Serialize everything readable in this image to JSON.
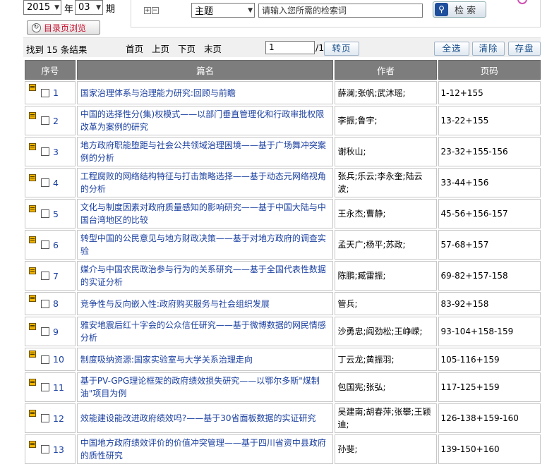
{
  "filters": {
    "year": "2015",
    "year_label": "年",
    "issue": "03",
    "issue_label": "期",
    "catalog_button": "目录页浏览"
  },
  "search": {
    "field": "主题",
    "placeholder": "请输入您所需的检索词",
    "button": "检 索"
  },
  "toolbar": {
    "result_count": "找到 15 条结果",
    "first": "首页",
    "prev": "上页",
    "next": "下页",
    "last": "末页",
    "page_value": "1",
    "page_total": "/1",
    "goto": "转页",
    "select_all": "全选",
    "clear": "清除",
    "save": "存盘"
  },
  "table": {
    "headers": [
      "序号",
      "篇名",
      "作者",
      "页码"
    ],
    "rows": [
      {
        "no": "1",
        "title": "国家治理体系与治理能力研究:回顾与前瞻",
        "author": "薛澜;张帆;武沐瑶;",
        "pages": "1-12+155"
      },
      {
        "no": "2",
        "title": "中国的选择性分(集)权模式——以部门垂直管理化和行政审批权限改革为案例的研究",
        "author": "李振;鲁宇;",
        "pages": "13-22+155"
      },
      {
        "no": "3",
        "title": "地方政府职能堕距与社会公共领域治理困境——基于广场舞冲突案例的分析",
        "author": "谢秋山;",
        "pages": "23-32+155-156"
      },
      {
        "no": "4",
        "title": "工程腐败的网络结构特征与打击策略选择——基于动态元网络视角的分析",
        "author": "张兵;乐云;李永奎;陆云波;",
        "pages": "33-44+156"
      },
      {
        "no": "5",
        "title": "文化与制度因素对政府质量感知的影响研究——基于中国大陆与中国台湾地区的比较",
        "author": "王永杰;曹静;",
        "pages": "45-56+156-157"
      },
      {
        "no": "6",
        "title": "转型中国的公民意见与地方财政决策——基于对地方政府的调查实验",
        "author": "孟天广;杨平;苏政;",
        "pages": "57-68+157"
      },
      {
        "no": "7",
        "title": "媒介与中国农民政治参与行为的关系研究——基于全国代表性数据的实证分析",
        "author": "陈鹏;臧雷振;",
        "pages": "69-82+157-158"
      },
      {
        "no": "8",
        "title": "竞争性与反向嵌入性:政府购买服务与社会组织发展",
        "author": "管兵;",
        "pages": "83-92+158"
      },
      {
        "no": "9",
        "title": "雅安地震后红十字会的公众信任研究——基于微博数据的网民情感分析",
        "author": "沙勇忠;阎劲松;王峥嵘;",
        "pages": "93-104+158-159"
      },
      {
        "no": "10",
        "title": "制度吸纳资源:国家实验室与大学关系治理走向",
        "author": "丁云龙;黄振羽;",
        "pages": "105-116+159"
      },
      {
        "no": "11",
        "title": "基于PV-GPG理论框架的政府绩效损失研究——以鄂尔多斯\"煤制油\"项目为例",
        "author": "包国宪;张弘;",
        "pages": "117-125+159"
      },
      {
        "no": "12",
        "title": "效能建设能改进政府绩效吗?——基于30省面板数据的实证研究",
        "author": "吴建南;胡春萍;张攀;王颖迪;",
        "pages": "126-138+159-160"
      },
      {
        "no": "13",
        "title": "中国地方政府绩效评价的价值冲突管理——基于四川省资中县政府的质性研究",
        "author": "孙斐;",
        "pages": "139-150+160"
      }
    ]
  }
}
